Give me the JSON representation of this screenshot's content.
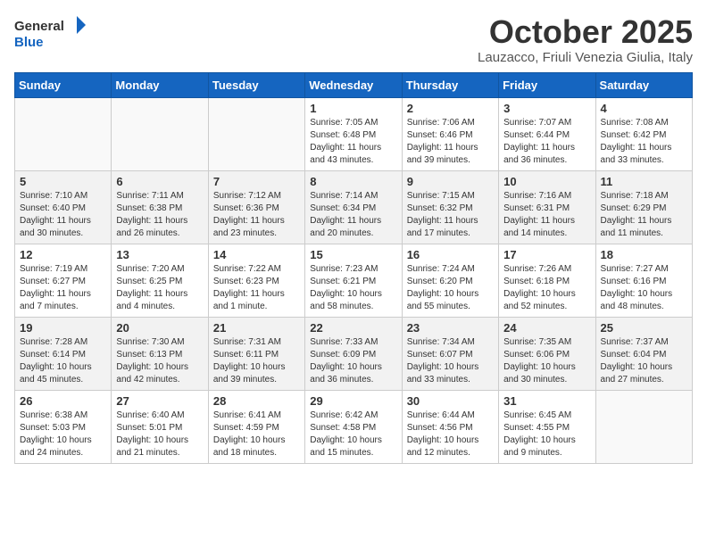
{
  "logo": {
    "general": "General",
    "blue": "Blue"
  },
  "header": {
    "month": "October 2025",
    "location": "Lauzacco, Friuli Venezia Giulia, Italy"
  },
  "weekdays": [
    "Sunday",
    "Monday",
    "Tuesday",
    "Wednesday",
    "Thursday",
    "Friday",
    "Saturday"
  ],
  "weeks": [
    {
      "alt": false,
      "days": [
        {
          "num": "",
          "info": ""
        },
        {
          "num": "",
          "info": ""
        },
        {
          "num": "",
          "info": ""
        },
        {
          "num": "1",
          "info": "Sunrise: 7:05 AM\nSunset: 6:48 PM\nDaylight: 11 hours\nand 43 minutes."
        },
        {
          "num": "2",
          "info": "Sunrise: 7:06 AM\nSunset: 6:46 PM\nDaylight: 11 hours\nand 39 minutes."
        },
        {
          "num": "3",
          "info": "Sunrise: 7:07 AM\nSunset: 6:44 PM\nDaylight: 11 hours\nand 36 minutes."
        },
        {
          "num": "4",
          "info": "Sunrise: 7:08 AM\nSunset: 6:42 PM\nDaylight: 11 hours\nand 33 minutes."
        }
      ]
    },
    {
      "alt": true,
      "days": [
        {
          "num": "5",
          "info": "Sunrise: 7:10 AM\nSunset: 6:40 PM\nDaylight: 11 hours\nand 30 minutes."
        },
        {
          "num": "6",
          "info": "Sunrise: 7:11 AM\nSunset: 6:38 PM\nDaylight: 11 hours\nand 26 minutes."
        },
        {
          "num": "7",
          "info": "Sunrise: 7:12 AM\nSunset: 6:36 PM\nDaylight: 11 hours\nand 23 minutes."
        },
        {
          "num": "8",
          "info": "Sunrise: 7:14 AM\nSunset: 6:34 PM\nDaylight: 11 hours\nand 20 minutes."
        },
        {
          "num": "9",
          "info": "Sunrise: 7:15 AM\nSunset: 6:32 PM\nDaylight: 11 hours\nand 17 minutes."
        },
        {
          "num": "10",
          "info": "Sunrise: 7:16 AM\nSunset: 6:31 PM\nDaylight: 11 hours\nand 14 minutes."
        },
        {
          "num": "11",
          "info": "Sunrise: 7:18 AM\nSunset: 6:29 PM\nDaylight: 11 hours\nand 11 minutes."
        }
      ]
    },
    {
      "alt": false,
      "days": [
        {
          "num": "12",
          "info": "Sunrise: 7:19 AM\nSunset: 6:27 PM\nDaylight: 11 hours\nand 7 minutes."
        },
        {
          "num": "13",
          "info": "Sunrise: 7:20 AM\nSunset: 6:25 PM\nDaylight: 11 hours\nand 4 minutes."
        },
        {
          "num": "14",
          "info": "Sunrise: 7:22 AM\nSunset: 6:23 PM\nDaylight: 11 hours\nand 1 minute."
        },
        {
          "num": "15",
          "info": "Sunrise: 7:23 AM\nSunset: 6:21 PM\nDaylight: 10 hours\nand 58 minutes."
        },
        {
          "num": "16",
          "info": "Sunrise: 7:24 AM\nSunset: 6:20 PM\nDaylight: 10 hours\nand 55 minutes."
        },
        {
          "num": "17",
          "info": "Sunrise: 7:26 AM\nSunset: 6:18 PM\nDaylight: 10 hours\nand 52 minutes."
        },
        {
          "num": "18",
          "info": "Sunrise: 7:27 AM\nSunset: 6:16 PM\nDaylight: 10 hours\nand 48 minutes."
        }
      ]
    },
    {
      "alt": true,
      "days": [
        {
          "num": "19",
          "info": "Sunrise: 7:28 AM\nSunset: 6:14 PM\nDaylight: 10 hours\nand 45 minutes."
        },
        {
          "num": "20",
          "info": "Sunrise: 7:30 AM\nSunset: 6:13 PM\nDaylight: 10 hours\nand 42 minutes."
        },
        {
          "num": "21",
          "info": "Sunrise: 7:31 AM\nSunset: 6:11 PM\nDaylight: 10 hours\nand 39 minutes."
        },
        {
          "num": "22",
          "info": "Sunrise: 7:33 AM\nSunset: 6:09 PM\nDaylight: 10 hours\nand 36 minutes."
        },
        {
          "num": "23",
          "info": "Sunrise: 7:34 AM\nSunset: 6:07 PM\nDaylight: 10 hours\nand 33 minutes."
        },
        {
          "num": "24",
          "info": "Sunrise: 7:35 AM\nSunset: 6:06 PM\nDaylight: 10 hours\nand 30 minutes."
        },
        {
          "num": "25",
          "info": "Sunrise: 7:37 AM\nSunset: 6:04 PM\nDaylight: 10 hours\nand 27 minutes."
        }
      ]
    },
    {
      "alt": false,
      "days": [
        {
          "num": "26",
          "info": "Sunrise: 6:38 AM\nSunset: 5:03 PM\nDaylight: 10 hours\nand 24 minutes."
        },
        {
          "num": "27",
          "info": "Sunrise: 6:40 AM\nSunset: 5:01 PM\nDaylight: 10 hours\nand 21 minutes."
        },
        {
          "num": "28",
          "info": "Sunrise: 6:41 AM\nSunset: 4:59 PM\nDaylight: 10 hours\nand 18 minutes."
        },
        {
          "num": "29",
          "info": "Sunrise: 6:42 AM\nSunset: 4:58 PM\nDaylight: 10 hours\nand 15 minutes."
        },
        {
          "num": "30",
          "info": "Sunrise: 6:44 AM\nSunset: 4:56 PM\nDaylight: 10 hours\nand 12 minutes."
        },
        {
          "num": "31",
          "info": "Sunrise: 6:45 AM\nSunset: 4:55 PM\nDaylight: 10 hours\nand 9 minutes."
        },
        {
          "num": "",
          "info": ""
        }
      ]
    }
  ]
}
